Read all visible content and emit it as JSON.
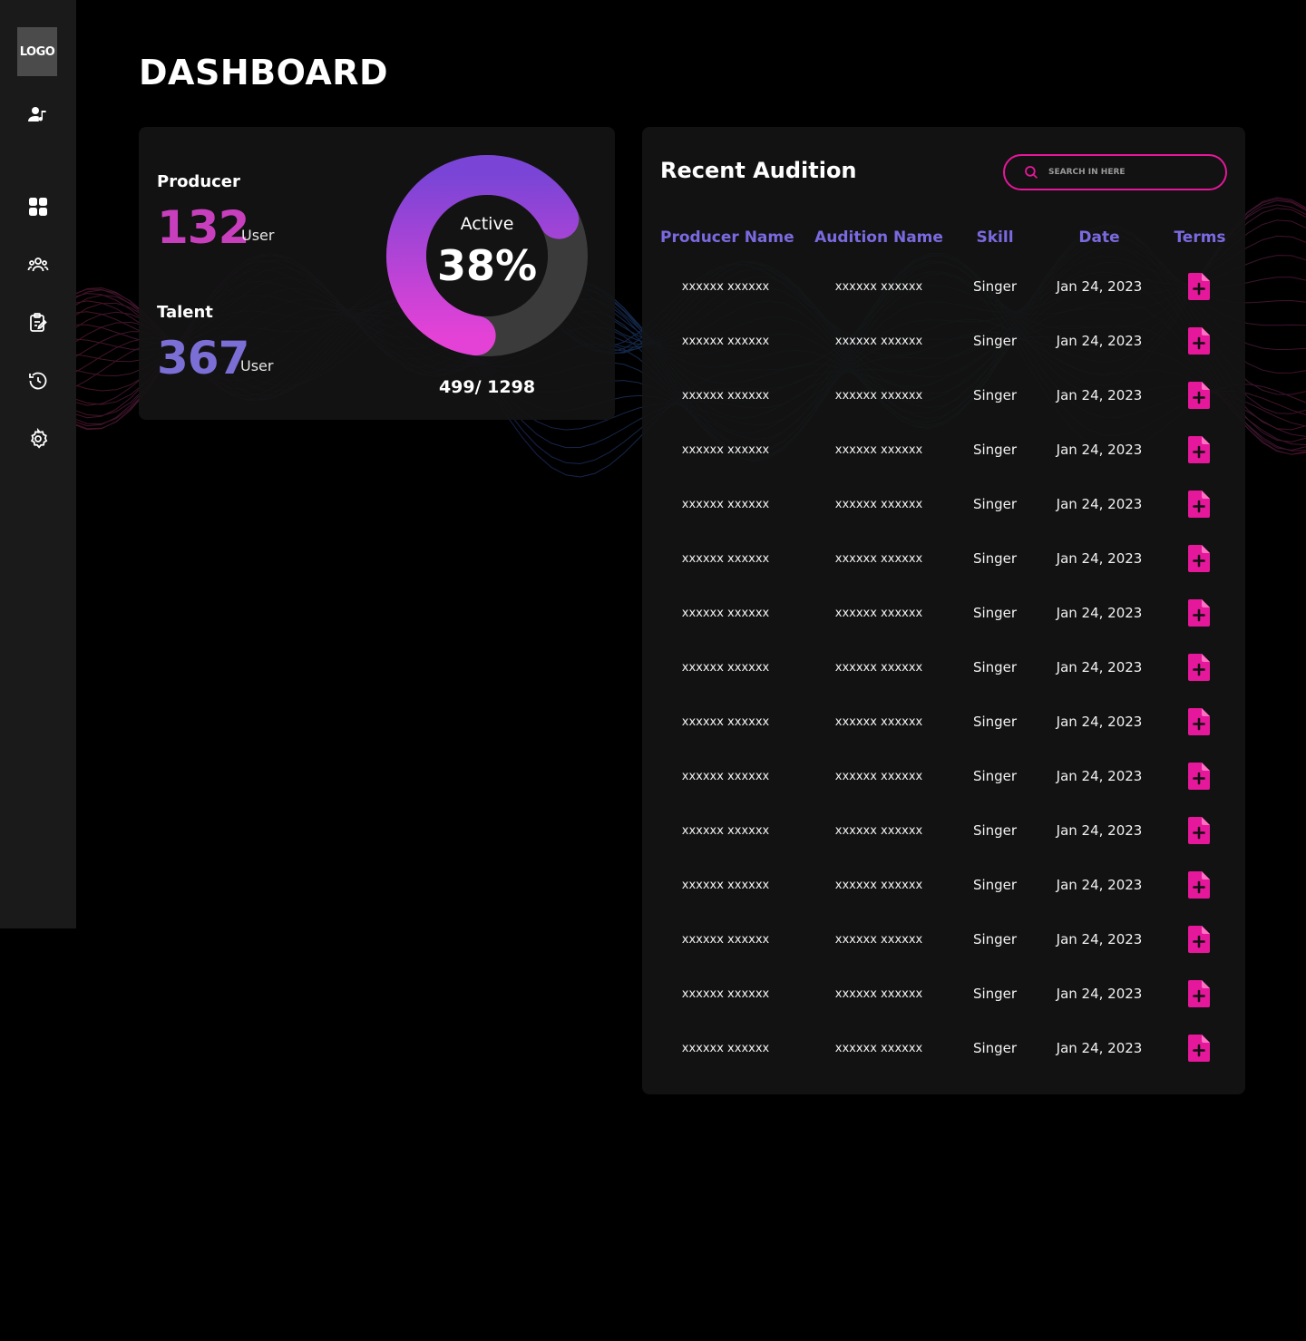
{
  "sidebar": {
    "logo": "LOGO",
    "icons": [
      "music-user-icon",
      "dashboard-grid-icon",
      "users-group-icon",
      "clipboard-edit-icon",
      "history-icon",
      "settings-gear-icon"
    ]
  },
  "page": {
    "title": "DASHBOARD"
  },
  "stats": {
    "producer": {
      "label": "Producer",
      "value": "132",
      "unit": "User",
      "color": "#c73fbd"
    },
    "talent": {
      "label": "Talent",
      "value": "367",
      "unit": "User",
      "color": "#7b6fd6"
    },
    "active": {
      "label": "Active",
      "percent_text": "38%",
      "fraction_text": "499/ 1298",
      "percent": 38
    }
  },
  "audition": {
    "title": "Recent Audition",
    "search_placeholder": "SEARCH IN HERE",
    "columns": [
      "Producer Name",
      "Audition Name",
      "Skill",
      "Date",
      "Terms"
    ],
    "rows": [
      {
        "producer": "xxxxxx xxxxxx",
        "audition": "xxxxxx xxxxxx",
        "skill": "Singer",
        "date": "Jan 24, 2023"
      },
      {
        "producer": "xxxxxx xxxxxx",
        "audition": "xxxxxx xxxxxx",
        "skill": "Singer",
        "date": "Jan 24, 2023"
      },
      {
        "producer": "xxxxxx xxxxxx",
        "audition": "xxxxxx xxxxxx",
        "skill": "Singer",
        "date": "Jan 24, 2023"
      },
      {
        "producer": "xxxxxx xxxxxx",
        "audition": "xxxxxx xxxxxx",
        "skill": "Singer",
        "date": "Jan 24, 2023"
      },
      {
        "producer": "xxxxxx xxxxxx",
        "audition": "xxxxxx xxxxxx",
        "skill": "Singer",
        "date": "Jan 24, 2023"
      },
      {
        "producer": "xxxxxx xxxxxx",
        "audition": "xxxxxx xxxxxx",
        "skill": "Singer",
        "date": "Jan 24, 2023"
      },
      {
        "producer": "xxxxxx xxxxxx",
        "audition": "xxxxxx xxxxxx",
        "skill": "Singer",
        "date": "Jan 24, 2023"
      },
      {
        "producer": "xxxxxx xxxxxx",
        "audition": "xxxxxx xxxxxx",
        "skill": "Singer",
        "date": "Jan 24, 2023"
      },
      {
        "producer": "xxxxxx xxxxxx",
        "audition": "xxxxxx xxxxxx",
        "skill": "Singer",
        "date": "Jan 24, 2023"
      },
      {
        "producer": "xxxxxx xxxxxx",
        "audition": "xxxxxx xxxxxx",
        "skill": "Singer",
        "date": "Jan 24, 2023"
      },
      {
        "producer": "xxxxxx xxxxxx",
        "audition": "xxxxxx xxxxxx",
        "skill": "Singer",
        "date": "Jan 24, 2023"
      },
      {
        "producer": "xxxxxx xxxxxx",
        "audition": "xxxxxx xxxxxx",
        "skill": "Singer",
        "date": "Jan 24, 2023"
      },
      {
        "producer": "xxxxxx xxxxxx",
        "audition": "xxxxxx xxxxxx",
        "skill": "Singer",
        "date": "Jan 24, 2023"
      },
      {
        "producer": "xxxxxx xxxxxx",
        "audition": "xxxxxx xxxxxx",
        "skill": "Singer",
        "date": "Jan 24, 2023"
      },
      {
        "producer": "xxxxxx xxxxxx",
        "audition": "xxxxxx xxxxxx",
        "skill": "Singer",
        "date": "Jan 24, 2023"
      }
    ]
  },
  "colors": {
    "accent_pink": "#e5179a",
    "header_purple": "#7a6ae0",
    "card_bg": "#141414",
    "sidebar_bg": "#1b1a1b"
  }
}
